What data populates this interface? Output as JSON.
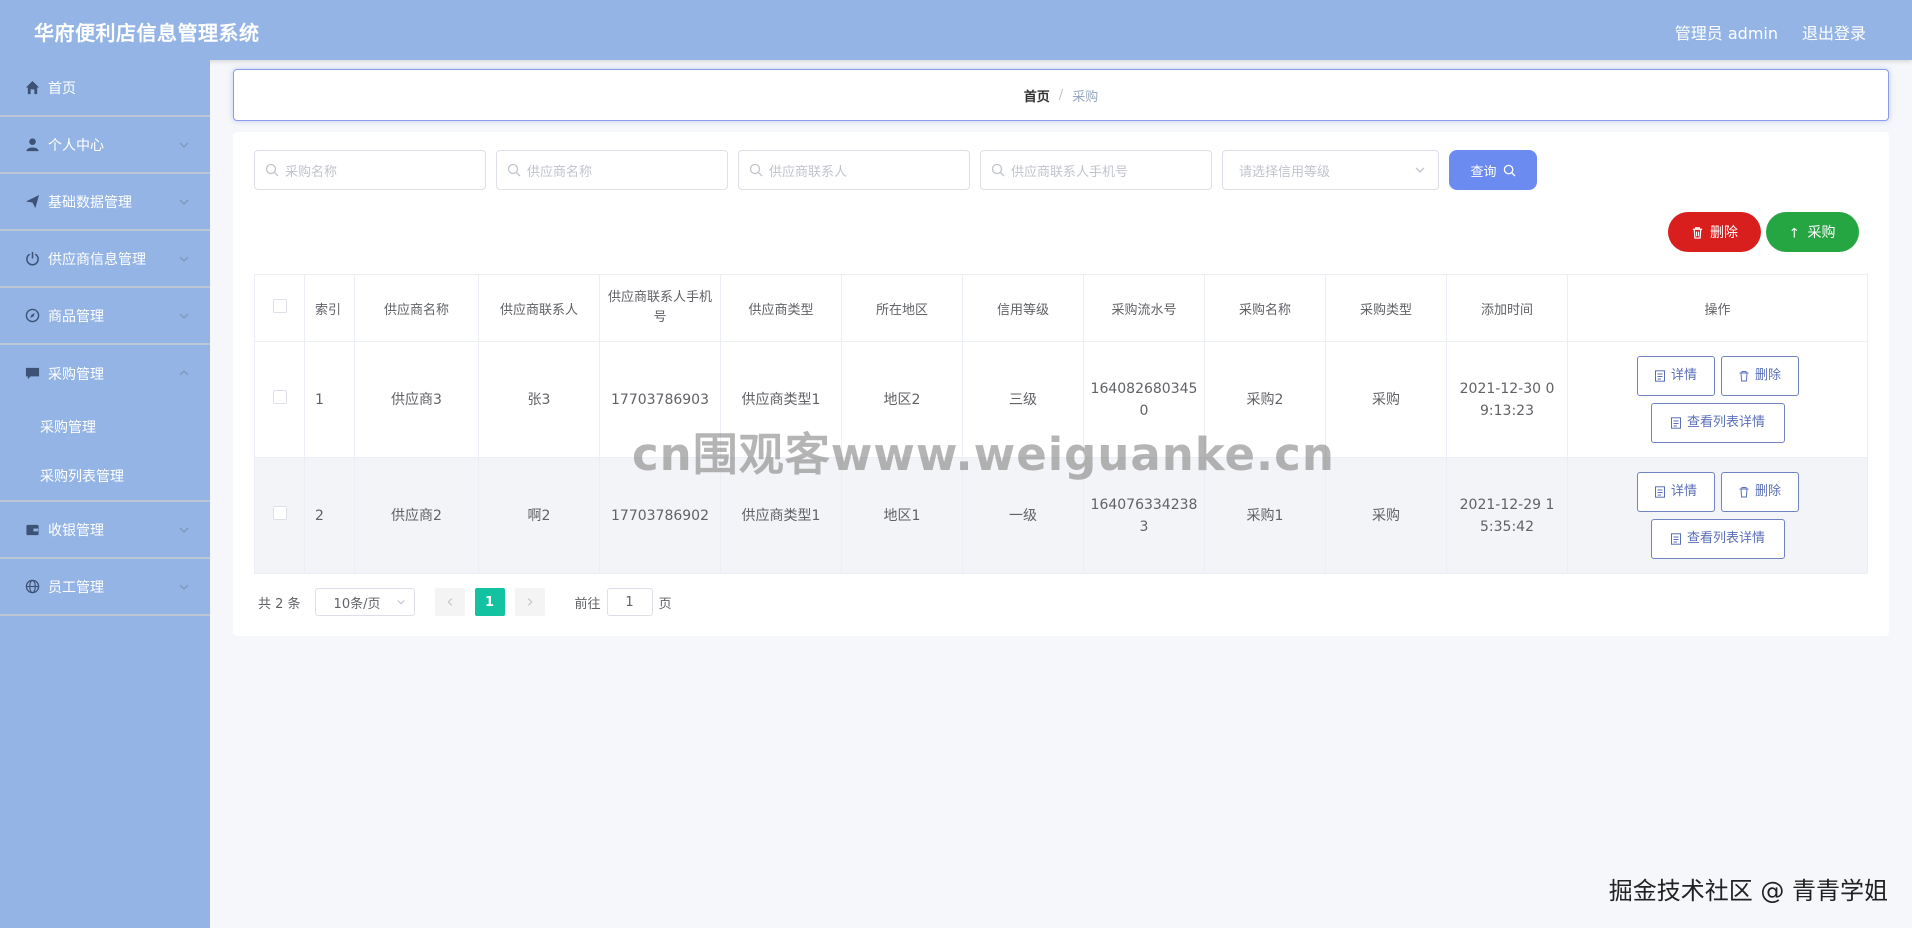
{
  "header": {
    "app_title": "华府便利店信息管理系统",
    "admin_label": "管理员 admin",
    "logout_label": "退出登录"
  },
  "sidebar": {
    "items": [
      {
        "label": "首页",
        "icon": "home-icon"
      },
      {
        "label": "个人中心",
        "icon": "user-icon"
      },
      {
        "label": "基础数据管理",
        "icon": "send-icon"
      },
      {
        "label": "供应商信息管理",
        "icon": "power-icon"
      },
      {
        "label": "商品管理",
        "icon": "compass-icon"
      },
      {
        "label": "采购管理",
        "icon": "chat-icon"
      },
      {
        "label": "收银管理",
        "icon": "wallet-icon"
      },
      {
        "label": "员工管理",
        "icon": "globe-icon"
      }
    ],
    "sub_items": [
      "采购管理",
      "采购列表管理"
    ]
  },
  "breadcrumb": {
    "home": "首页",
    "separator": "/",
    "current": "采购"
  },
  "search": {
    "purchase_name_placeholder": "采购名称",
    "supplier_name_placeholder": "供应商名称",
    "supplier_contact_placeholder": "供应商联系人",
    "supplier_phone_placeholder": "供应商联系人手机号",
    "credit_select_placeholder": "请选择信用等级",
    "query_label": "查询"
  },
  "actions": {
    "delete_label": "删除",
    "purchase_label": "采购",
    "delete_color": "#d91e1e",
    "purchase_color": "#26a643",
    "query_color": "#6c8bf0"
  },
  "table": {
    "headers": [
      "索引",
      "供应商名称",
      "供应商联系人",
      "供应商联系人手机号",
      "供应商类型",
      "所在地区",
      "信用等级",
      "采购流水号",
      "采购名称",
      "采购类型",
      "添加时间",
      "操作"
    ],
    "rows": [
      {
        "index": "1",
        "supplier": "供应商3",
        "contact": "张3",
        "phone": "17703786903",
        "type": "供应商类型1",
        "region": "地区2",
        "credit": "三级",
        "serial": "1640826803450",
        "name": "采购2",
        "ptype": "采购",
        "time": "2021-12-30 09:13:23"
      },
      {
        "index": "2",
        "supplier": "供应商2",
        "contact": "啊2",
        "phone": "17703786902",
        "type": "供应商类型1",
        "region": "地区1",
        "credit": "一级",
        "serial": "1640763342383",
        "name": "采购1",
        "ptype": "采购",
        "time": "2021-12-29 15:35:42"
      }
    ],
    "op_detail": "详情",
    "op_delete": "删除",
    "op_list_detail": "查看列表详情"
  },
  "pager": {
    "total": "共 2 条",
    "page_size": "10条/页",
    "current_page": "1",
    "goto_label": "前往",
    "goto_value": "1",
    "page_suffix": "页",
    "active_color": "#13c2a0"
  },
  "watermarks": {
    "center": "cn围观客www.weiguanke.cn",
    "corner": "掘金技术社区 @ 青青学姐"
  }
}
